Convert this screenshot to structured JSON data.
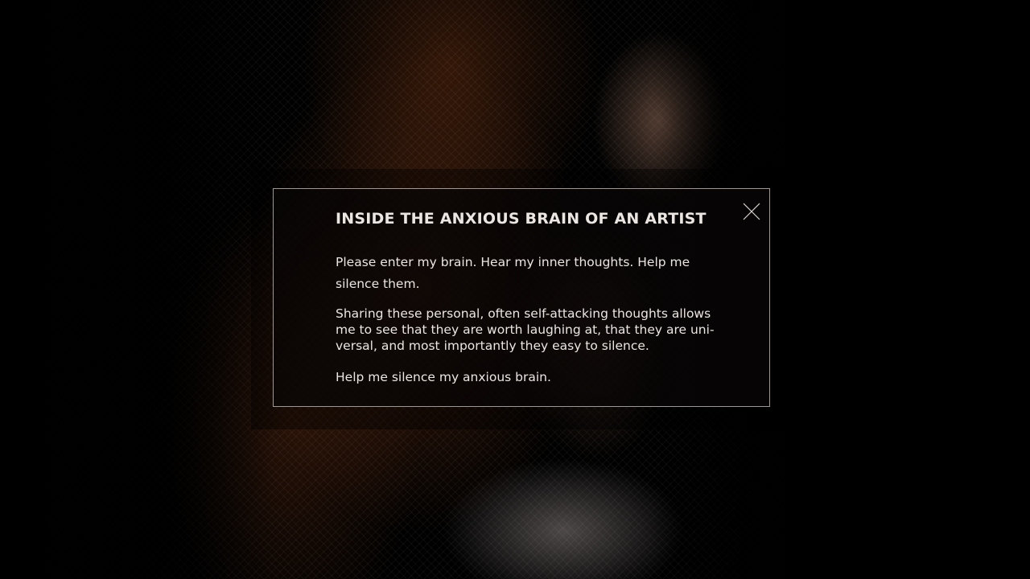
{
  "dialog": {
    "title": "INSIDE THE ANXIOUS BRAIN OF AN ARTIST",
    "paragraphs": [
      "Please enter my brain. Hear my inner thoughts. Help me silence them.",
      "Sharing these personal, often self-attacking thoughts allows me to see that they are worth laughing at, that they are uni­versal, and most importantly they easy to silence.",
      "Help me silence my anxious brain."
    ],
    "close_icon": "close-icon"
  },
  "colors": {
    "text": "#ece6e2",
    "border": "#d2c8c3",
    "background": "#000000"
  }
}
